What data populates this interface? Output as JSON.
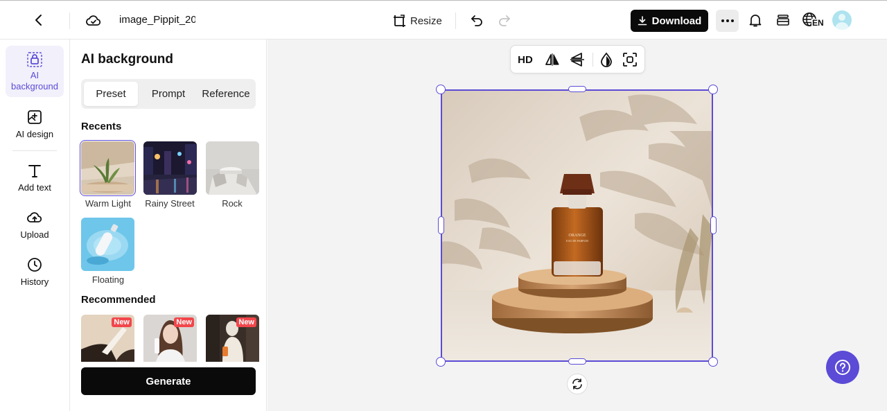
{
  "header": {
    "filename": "image_Pippit_20",
    "resize_label": "Resize",
    "download_label": "Download",
    "language": "EN"
  },
  "rail": {
    "items": [
      {
        "label": "AI background",
        "icon": "ai-background-icon",
        "active": true
      },
      {
        "label": "AI design",
        "icon": "ai-design-icon"
      },
      {
        "label": "Add text",
        "icon": "text-icon"
      },
      {
        "label": "Upload",
        "icon": "cloud-upload-icon"
      },
      {
        "label": "History",
        "icon": "clock-icon"
      }
    ]
  },
  "panel": {
    "title": "AI background",
    "tabs": [
      "Preset",
      "Prompt",
      "Reference"
    ],
    "active_tab": "Preset",
    "recents_label": "Recents",
    "recents": [
      "Warm Light",
      "Rainy Street",
      "Rock",
      "Floating"
    ],
    "recommended_label": "Recommended",
    "new_badge": "New",
    "generate_label": "Generate"
  },
  "canvas": {
    "toolbar": {
      "hd_label": "HD"
    }
  },
  "colors": {
    "accent": "#5b4bd6",
    "primary_button": "#0a0a0a",
    "badge": "#f2464b"
  }
}
